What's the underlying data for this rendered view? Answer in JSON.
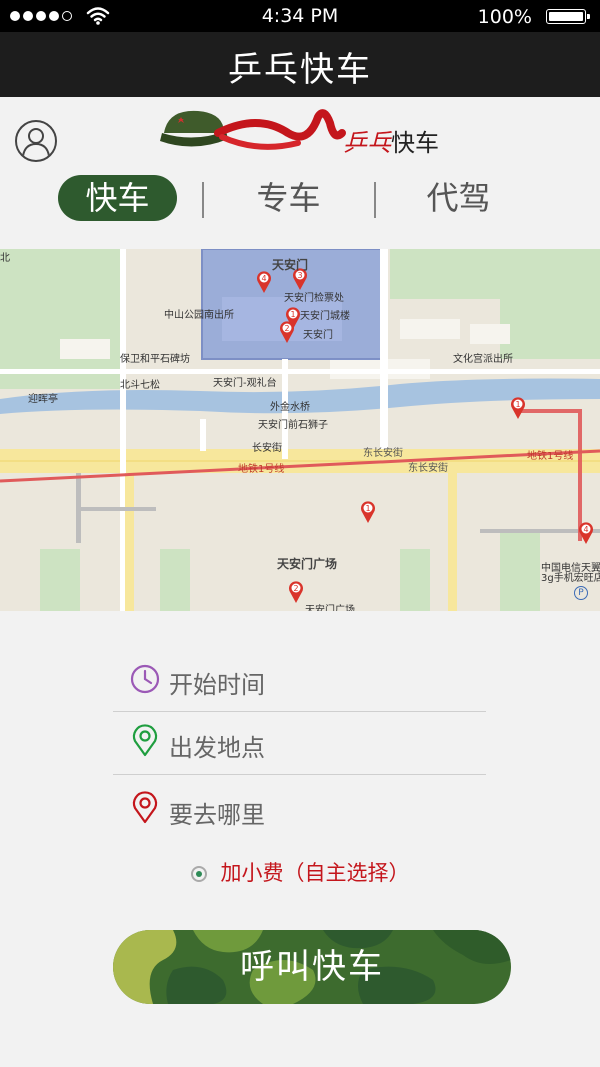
{
  "status_bar": {
    "time": "4:34 PM",
    "battery_percent": "100%",
    "signal_bars": 4
  },
  "nav": {
    "title": "乒乓快车"
  },
  "brand": {
    "logo_text_red": "乒乓",
    "logo_text": "快车"
  },
  "tabs": [
    {
      "label": "快车",
      "active": true
    },
    {
      "label": "专车",
      "active": false
    },
    {
      "label": "代驾",
      "active": false
    }
  ],
  "map": {
    "labels": {
      "tiananmen": "天安门",
      "tiananmen_viewing": "天安门检票处",
      "tiananmen_tower": "天安门城楼",
      "tiananmen_small": "天安门",
      "zhongshan": "中山公园南出所",
      "baowei": "保卫和平石碑坊",
      "beidou": "北斗七松",
      "guanlitai": "天安门-观礼台",
      "yinhui": "迎晖亭",
      "jinshui": "外金水桥",
      "shishizi": "天安门前石狮子",
      "changanjie": "长安街",
      "dongchangan1": "东长安街",
      "dongchangan2": "东长安街",
      "subway1": "地铁1号线",
      "subway2": "地铁1号线",
      "wenhua": "文化宫派出所",
      "square": "天安门广场",
      "square_small": "天安门广场",
      "telecom1": "中国电信天翼",
      "telecom2": "3g手机宏旺店",
      "north": "北",
      "parking": "P"
    },
    "markers": [
      "4",
      "3",
      "1",
      "2",
      "1",
      "4",
      "1",
      "2"
    ]
  },
  "form": {
    "start_time": "开始时间",
    "departure": "出发地点",
    "destination": "要去哪里",
    "extra_fee": "加小费（自主选择）"
  },
  "call_button": {
    "label": "呼叫快车"
  },
  "colors": {
    "accent_green": "#2e5a2e",
    "brand_red": "#c4161c",
    "nav_bg": "#1d1d1d"
  },
  "icons": {
    "signal": "signal-dots-icon",
    "wifi": "wifi-icon",
    "battery": "battery-icon",
    "avatar": "user-avatar-icon",
    "clock": "clock-icon",
    "pin_green": "location-pin-icon",
    "pin_red": "destination-pin-icon"
  }
}
